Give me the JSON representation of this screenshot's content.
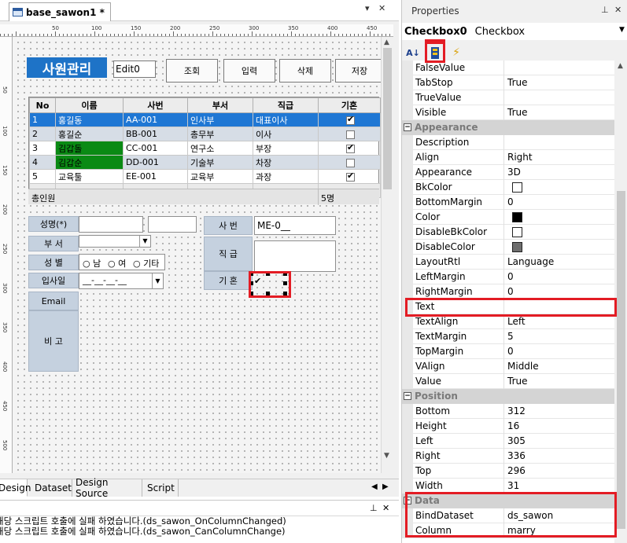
{
  "designer": {
    "doc_tab_title": "base_sawon1 *",
    "ruler_labels": [
      "50",
      "100",
      "150",
      "200",
      "250",
      "300",
      "350",
      "400",
      "450"
    ],
    "vruler_labels": [
      "50",
      "100",
      "150",
      "200",
      "250",
      "300",
      "350",
      "400",
      "450",
      "500"
    ],
    "form": {
      "title": "사원관리",
      "edit0_value": "Edit0",
      "buttons": [
        "조회",
        "입력",
        "삭제",
        "저장"
      ],
      "grid": {
        "columns": [
          "No",
          "이름",
          "사번",
          "부서",
          "직급",
          "기혼"
        ],
        "rows": [
          {
            "no": "1",
            "name": "홍길동",
            "id": "AA-001",
            "dept": "인사부",
            "rank": "대표이사",
            "married": true,
            "style": "selected",
            "name_green": false
          },
          {
            "no": "2",
            "name": "홍길순",
            "id": "BB-001",
            "dept": "총무부",
            "rank": "이사",
            "married": false,
            "style": "alt",
            "name_green": false
          },
          {
            "no": "3",
            "name": "김갑돌",
            "id": "CC-001",
            "dept": "연구소",
            "rank": "부장",
            "married": true,
            "style": "normal",
            "name_green": true
          },
          {
            "no": "4",
            "name": "김갑순",
            "id": "DD-001",
            "dept": "기술부",
            "rank": "차장",
            "married": false,
            "style": "alt",
            "name_green": true
          },
          {
            "no": "5",
            "name": "교육툴",
            "id": "EE-001",
            "dept": "교육부",
            "rank": "과장",
            "married": true,
            "style": "normal",
            "name_green": false
          }
        ],
        "footer_label": "총인원",
        "footer_count": "5명"
      },
      "labels": {
        "name": "성명(*)",
        "dept": "부 서",
        "gender": "성 별",
        "join_date": "입사일",
        "email": "Email",
        "note": "비 고",
        "emp_no": "사 번",
        "rank": "직 급",
        "married": "기 혼"
      },
      "radio_options": [
        "남",
        "여",
        "기타"
      ],
      "date_mask": "__-__-__-__",
      "emp_no_value": "ME-0__"
    }
  },
  "bottom_tabs": [
    "Design",
    "Dataset",
    "Design Source",
    "Script"
  ],
  "output_lines": [
    "해당 스크립트 호출에 실패 하였습니다.(ds_sawon_OnColumnChanged)",
    "해당 스크립트 호출에 실패 하였습니다.(ds_sawon_CanColumnChange)"
  ],
  "properties": {
    "panel_title": "Properties",
    "object_name": "Checkbox0",
    "object_type": "Checkbox",
    "pin_icon": "pin-icon",
    "close_icon": "close-icon",
    "rows": [
      {
        "kind": "prop",
        "name": "FalseValue",
        "value": ""
      },
      {
        "kind": "prop",
        "name": "TabStop",
        "value": "True"
      },
      {
        "kind": "prop",
        "name": "TrueValue",
        "value": ""
      },
      {
        "kind": "prop",
        "name": "Visible",
        "value": "True"
      },
      {
        "kind": "cat",
        "name": "Appearance"
      },
      {
        "kind": "prop",
        "name": "Description",
        "value": ""
      },
      {
        "kind": "prop",
        "name": "Align",
        "value": "Right"
      },
      {
        "kind": "prop",
        "name": "Appearance",
        "value": "3D"
      },
      {
        "kind": "prop",
        "name": "BkColor",
        "value": "",
        "swatch": "#ffffff"
      },
      {
        "kind": "prop",
        "name": "BottomMargin",
        "value": "0"
      },
      {
        "kind": "prop",
        "name": "Color",
        "value": "",
        "swatch": "#000000"
      },
      {
        "kind": "prop",
        "name": "DisableBkColor",
        "value": "",
        "swatch": "#ffffff"
      },
      {
        "kind": "prop",
        "name": "DisableColor",
        "value": "",
        "swatch": "#6e6e6e"
      },
      {
        "kind": "prop",
        "name": "LayoutRtl",
        "value": "Language"
      },
      {
        "kind": "prop",
        "name": "LeftMargin",
        "value": "0"
      },
      {
        "kind": "prop",
        "name": "RightMargin",
        "value": "0"
      },
      {
        "kind": "prop",
        "name": "Text",
        "value": ""
      },
      {
        "kind": "prop",
        "name": "TextAlign",
        "value": "Left"
      },
      {
        "kind": "prop",
        "name": "TextMargin",
        "value": "5"
      },
      {
        "kind": "prop",
        "name": "TopMargin",
        "value": "0"
      },
      {
        "kind": "prop",
        "name": "VAlign",
        "value": "Middle"
      },
      {
        "kind": "prop",
        "name": "Value",
        "value": "True"
      },
      {
        "kind": "cat",
        "name": "Position"
      },
      {
        "kind": "prop",
        "name": "Bottom",
        "value": "312"
      },
      {
        "kind": "prop",
        "name": "Height",
        "value": "16"
      },
      {
        "kind": "prop",
        "name": "Left",
        "value": "305"
      },
      {
        "kind": "prop",
        "name": "Right",
        "value": "336"
      },
      {
        "kind": "prop",
        "name": "Top",
        "value": "296"
      },
      {
        "kind": "prop",
        "name": "Width",
        "value": "31"
      },
      {
        "kind": "cat",
        "name": "Data"
      },
      {
        "kind": "prop",
        "name": "BindDataset",
        "value": "ds_sawon"
      },
      {
        "kind": "prop",
        "name": "Column",
        "value": "marry"
      }
    ]
  },
  "colors": {
    "highlight_red": "#e31c24",
    "title_blue": "#1e73c7",
    "grid_selected": "#1f77d4",
    "label_bg": "#c5d1df"
  }
}
